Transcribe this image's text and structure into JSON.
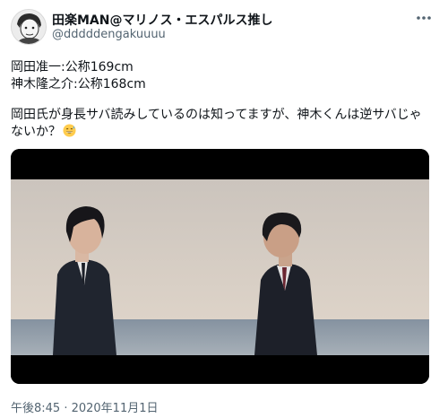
{
  "user": {
    "display_name": "田楽MAN@マリノス・エスパルス推し",
    "handle": "@dddddengakuuuu"
  },
  "tweet": {
    "line1": "岡田准一:公称169cm",
    "line2": "神木隆之介:公称168cm",
    "line3": "岡田氏が身長サバ読みしているのは知ってますが、神木くんは逆サバじゃ",
    "line4": "ないか？",
    "emoji": "grinning-sweat-emoji"
  },
  "media": {
    "type": "video-still",
    "description_icon": "movie-still"
  },
  "meta": {
    "timestamp": "午後8:45 · 2020年11月1日"
  },
  "colors": {
    "text": "#0f1419",
    "secondary": "#536471",
    "sky": "#d4c9bd",
    "sea": "#8e9aa6"
  },
  "icons": {
    "more": "more-options-icon"
  }
}
